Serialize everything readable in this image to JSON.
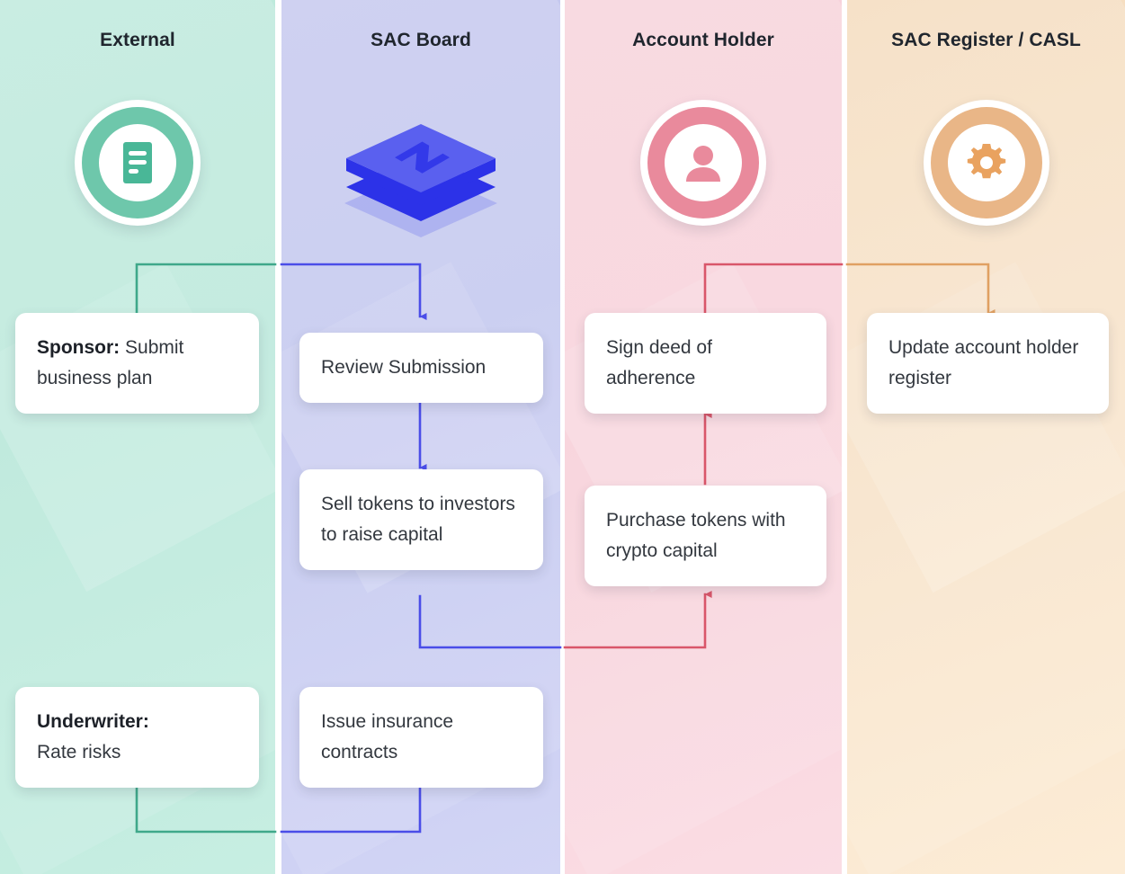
{
  "diagram": {
    "type": "swimlane-flowchart",
    "title": "SAC tokenised insurance process swimlane"
  },
  "lanes": [
    {
      "id": "external",
      "title": "External",
      "color": "#bfeadd",
      "accent": "#3fa88a",
      "icon": "document-icon",
      "icon_style": "ring-green"
    },
    {
      "id": "sac-board",
      "title": "SAC Board",
      "color": "#c6c9ef",
      "accent": "#4a4de8",
      "icon": "stacked-layers-n-icon",
      "icon_style": "iso-cube"
    },
    {
      "id": "account-holder",
      "title": "Account Holder",
      "color": "#f7d3dc",
      "accent": "#d9566a",
      "icon": "user-icon",
      "icon_style": "ring-pink"
    },
    {
      "id": "sac-register",
      "title": "SAC Register / CASL",
      "color": "#f5dcbe",
      "accent": "#e0a062",
      "icon": "gear-icon",
      "icon_style": "ring-orange"
    }
  ],
  "nodes": [
    {
      "id": "sponsor",
      "lane": "external",
      "label_bold": "Sponsor:",
      "label_rest": " Submit business plan",
      "text": "Sponsor: Submit business plan"
    },
    {
      "id": "review-submission",
      "lane": "sac-board",
      "label_bold": "",
      "label_rest": "Review Submission",
      "text": "Review Submission"
    },
    {
      "id": "sign-deed",
      "lane": "account-holder",
      "label_bold": "",
      "label_rest": "Sign deed of adherence",
      "text": "Sign deed of adherence"
    },
    {
      "id": "update-register",
      "lane": "sac-register",
      "label_bold": "",
      "label_rest": "Update account holder register",
      "text": "Update account holder register"
    },
    {
      "id": "sell-tokens",
      "lane": "sac-board",
      "label_bold": "",
      "label_rest": "Sell tokens to investors to raise capital",
      "text": "Sell tokens to investors to raise capital"
    },
    {
      "id": "purchase-tokens",
      "lane": "account-holder",
      "label_bold": "",
      "label_rest": "Purchase tokens with crypto capital",
      "text": "Purchase tokens with crypto capital"
    },
    {
      "id": "underwriter",
      "lane": "external",
      "label_bold": "Underwriter:",
      "label_rest": "Rate risks",
      "text": "Underwriter: Rate risks"
    },
    {
      "id": "issue-contracts",
      "lane": "sac-board",
      "label_bold": "",
      "label_rest": "Issue insurance contracts",
      "text": "Issue insurance contracts"
    }
  ],
  "connectors": [
    {
      "id": "sponsor-to-review",
      "from": "sponsor",
      "to": "review-submission",
      "color": "#3fa88a",
      "color2": "#4a4de8",
      "arrow": true
    },
    {
      "id": "review-to-sell",
      "from": "review-submission",
      "to": "sell-tokens",
      "color": "#4a4de8",
      "arrow": true
    },
    {
      "id": "sell-to-purchase",
      "from": "sell-tokens",
      "to": "purchase-tokens",
      "color": "#4a4de8",
      "color2": "#d9566a",
      "arrow": true
    },
    {
      "id": "purchase-to-sign",
      "from": "purchase-tokens",
      "to": "sign-deed",
      "color": "#d9566a",
      "arrow": true
    },
    {
      "id": "sign-to-update",
      "from": "sign-deed",
      "to": "update-register",
      "color": "#d9566a",
      "color2": "#e0a062",
      "arrow": true
    },
    {
      "id": "underwriter-to-issue",
      "from": "underwriter",
      "to": "issue-contracts",
      "color": "#3fa88a",
      "color2": "#4a4de8",
      "arrow": true
    }
  ],
  "colors": {
    "green_accent": "#3fa88a",
    "blue_accent": "#4a4de8",
    "pink_accent": "#d9566a",
    "orange_accent": "#e0a062",
    "card_bg": "#ffffff",
    "text": "#33383f",
    "title_text": "#20262e"
  }
}
